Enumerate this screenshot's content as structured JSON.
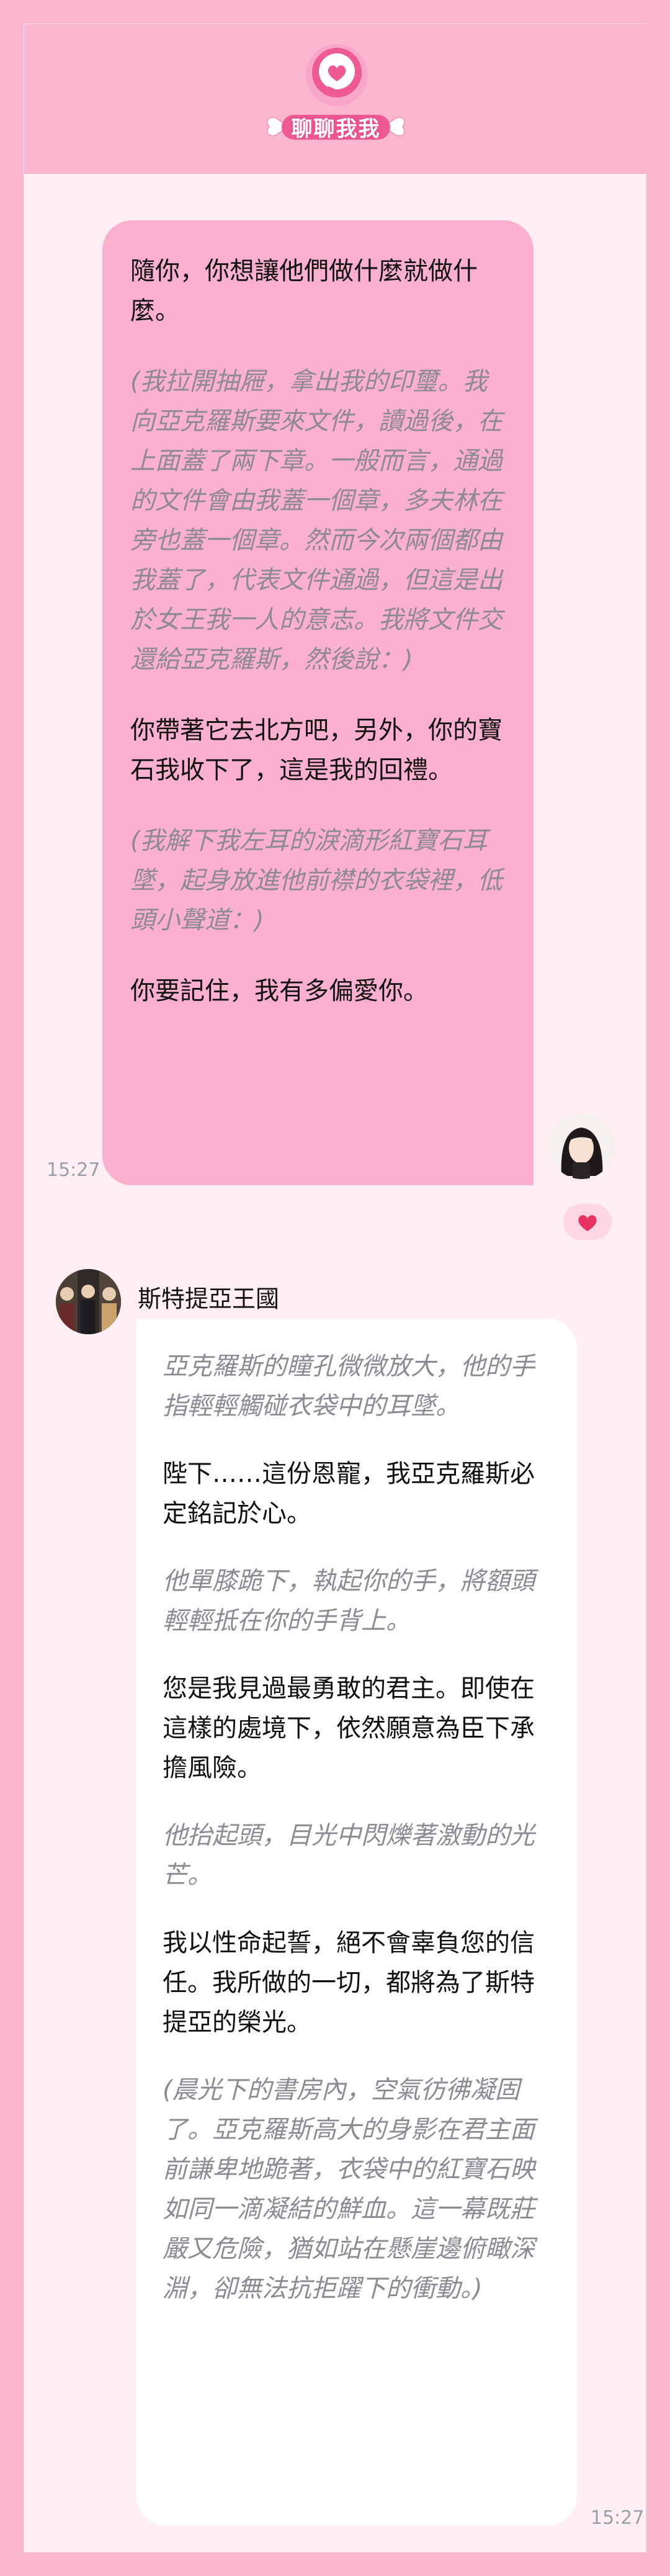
{
  "header": {
    "title": "聊聊我我"
  },
  "user_message": {
    "paragraphs": [
      {
        "text": "隨你，你想讓他們做什麼就做什麼。",
        "style": "speech"
      },
      {
        "text": "(我拉開抽屜，拿出我的印璽。我向亞克羅斯要來文件，讀過後，在上面蓋了兩下章。一般而言，通過的文件會由我蓋一個章，多夫林在旁也蓋一個章。然而今次兩個都由我蓋了，代表文件通過，但這是出於女王我一人的意志。我將文件交還給亞克羅斯，然後說：)",
        "style": "narration"
      },
      {
        "text": "你帶著它去北方吧，另外，你的寶石我收下了，這是我的回禮。",
        "style": "speech"
      },
      {
        "text": "(我解下我左耳的淚滴形紅寶石耳墜，起身放進他前襟的衣袋裡，低頭小聲道：)",
        "style": "narration"
      },
      {
        "text": "你要記住，我有多偏愛你。",
        "style": "speech"
      }
    ],
    "time": "15:27"
  },
  "bot": {
    "name": "斯特提亞王國",
    "time": "15:27",
    "paragraphs": [
      {
        "text": "亞克羅斯的瞳孔微微放大，他的手指輕輕觸碰衣袋中的耳墜。",
        "style": "narration"
      },
      {
        "text": "陛下……這份恩寵，我亞克羅斯必定銘記於心。",
        "style": "speech"
      },
      {
        "text": "他單膝跪下，執起你的手，將額頭輕輕抵在你的手背上。",
        "style": "narration"
      },
      {
        "text": "您是我見過最勇敢的君主。即使在這樣的處境下，依然願意為臣下承擔風險。",
        "style": "speech"
      },
      {
        "text": "他抬起頭，目光中閃爍著激動的光芒。",
        "style": "narration"
      },
      {
        "text": "我以性命起誓，絕不會辜負您的信任。我所做的一切，都將為了斯特提亞的榮光。",
        "style": "speech"
      },
      {
        "text": "(晨光下的書房內，空氣彷彿凝固了。亞克羅斯高大的身影在君主面前謙卑地跪著，衣袋中的紅寶石映如同一滴凝結的鮮血。這一幕既莊嚴又危險，猶如站在懸崖邊俯瞰深淵，卻無法抗拒躍下的衝動。)",
        "style": "narration"
      }
    ]
  },
  "icons": {
    "logo": "heart-chat-icon",
    "like": "heart-icon"
  },
  "colors": {
    "background": "#fbb7cf",
    "card": "#ffeef4",
    "user_bubble": "#fbb0cd",
    "bot_bubble": "#ffffff",
    "narration_text": "#8d8a92",
    "accent": "#e24f85"
  }
}
